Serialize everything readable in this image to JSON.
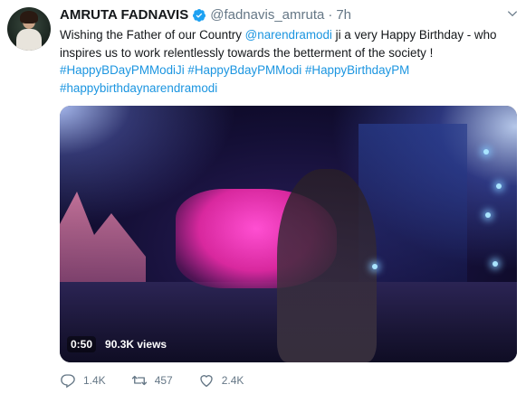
{
  "tweet": {
    "author_name": "AMRUTA FADNAVIS",
    "handle": "@fadnavis_amruta",
    "separator": "·",
    "time": "7h",
    "text_part1": "Wishing the Father of our Country ",
    "mention": "@narendramodi",
    "text_part2": " ji a very Happy Birthday - who inspires us to work relentlessly towards the betterment of the society !",
    "hashtags": [
      "#HappyBDayPMModiJi",
      "#HappyBdayPMModi",
      "#HappyBirthdayPM",
      "#happybirthdaynarendramodi"
    ]
  },
  "video": {
    "duration": "0:50",
    "views": "90.3K views"
  },
  "actions": {
    "reply_count": "1.4K",
    "retweet_count": "457",
    "like_count": "2.4K"
  },
  "icons": {
    "verified": "verified-badge-icon",
    "chevron": "chevron-down-icon",
    "reply": "reply-icon",
    "retweet": "retweet-icon",
    "like": "heart-icon"
  },
  "colors": {
    "link": "#1b95e0",
    "muted": "#657786",
    "verified": "#1da1f2"
  }
}
